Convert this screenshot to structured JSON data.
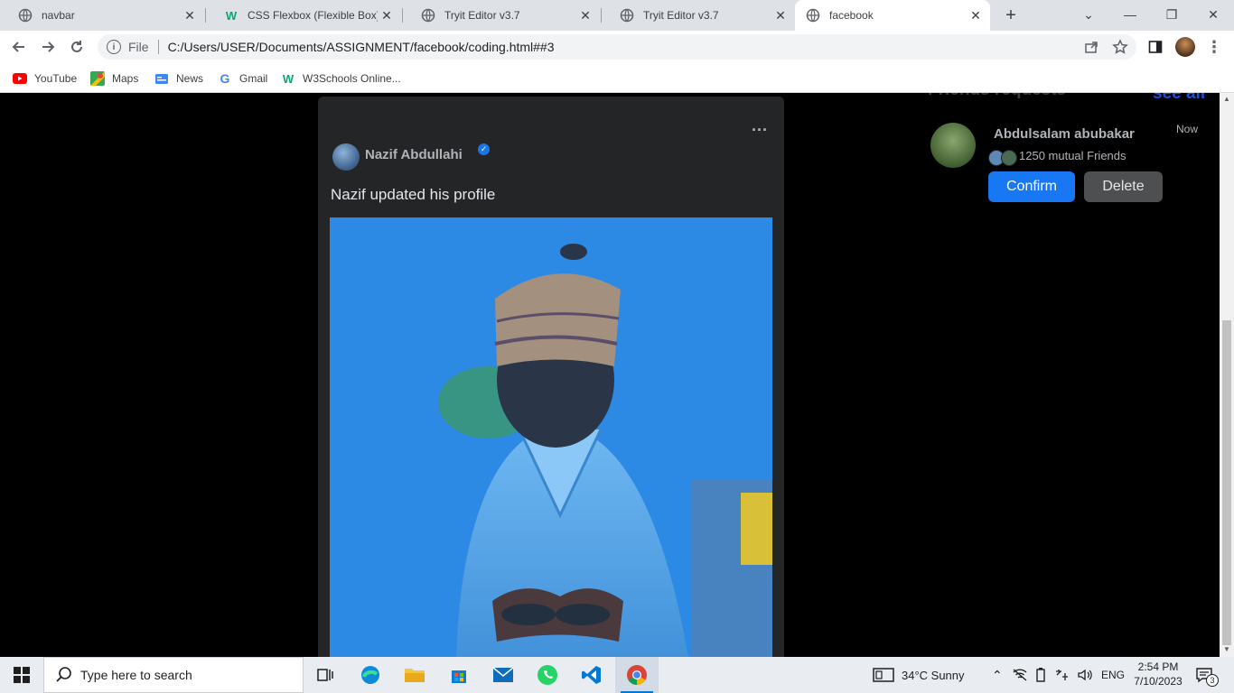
{
  "browser": {
    "tabs": [
      {
        "label": "navbar",
        "icon": "globe-icon"
      },
      {
        "label": "CSS Flexbox (Flexible Box)",
        "icon": "w3schools-icon"
      },
      {
        "label": "Tryit Editor v3.7",
        "icon": "globe-icon"
      },
      {
        "label": "Tryit Editor v3.7",
        "icon": "globe-icon"
      },
      {
        "label": "facebook",
        "icon": "globe-icon",
        "active": true
      }
    ],
    "scheme": "File",
    "url": "C:/Users/USER/Documents/ASSIGNMENT/facebook/coding.html##3",
    "bookmarks": [
      {
        "label": "YouTube",
        "icon": "youtube-icon"
      },
      {
        "label": "Maps",
        "icon": "maps-icon"
      },
      {
        "label": "News",
        "icon": "news-icon"
      },
      {
        "label": "Gmail",
        "icon": "google-icon"
      },
      {
        "label": "W3Schools Online...",
        "icon": "w3schools-icon"
      }
    ]
  },
  "post": {
    "author": "Nazif Abdullahi",
    "text": "Nazif updated his profile",
    "menu_glyph": "..."
  },
  "friend_requests": {
    "title": "Friends requests",
    "see_all": "see all",
    "request": {
      "name": "Abdulsalam abubakar",
      "time": "Now",
      "mutual": "1250 mutual Friends",
      "confirm_label": "Confirm",
      "delete_label": "Delete"
    }
  },
  "taskbar": {
    "search_placeholder": "Type here to search",
    "weather": "34°C  Sunny",
    "language": "ENG",
    "time": "2:54 PM",
    "date": "7/10/2023",
    "notifications": "3"
  },
  "colors": {
    "accent": "#1877f2",
    "card": "#242526",
    "page_bg": "#000000"
  }
}
